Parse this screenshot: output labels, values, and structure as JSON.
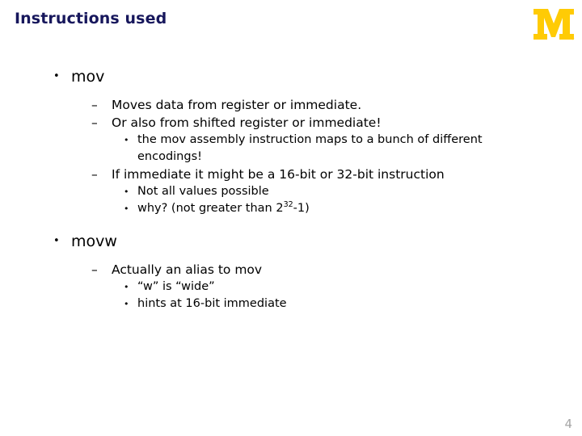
{
  "slide": {
    "title": "Instructions used",
    "page_number": "4",
    "title_color": "#17175c",
    "logo": {
      "name": "university-of-michigan-block-m",
      "letter": "M",
      "color": "#ffcb05"
    },
    "outline": [
      {
        "level": 1,
        "bullet": "•",
        "text": "mov"
      },
      {
        "level": 2,
        "bullet": "–",
        "text": "Moves data from register or immediate."
      },
      {
        "level": 2,
        "bullet": "–",
        "text": "Or also from shifted register or immediate!"
      },
      {
        "level": 3,
        "bullet": "•",
        "text": "the mov assembly instruction maps to a bunch of different encodings!"
      },
      {
        "level": 2,
        "bullet": "–",
        "text": "If immediate it might be a 16-bit or 32-bit instruction"
      },
      {
        "level": 3,
        "bullet": "•",
        "text": "Not all values possible"
      },
      {
        "level": 3,
        "bullet": "•",
        "text_before_sup": "why? (not greater than 2",
        "sup": "32",
        "text_after_sup": "-1)"
      },
      {
        "level": 1,
        "bullet": "•",
        "text": "movw"
      },
      {
        "level": 2,
        "bullet": "–",
        "text": "Actually an alias to mov"
      },
      {
        "level": 3,
        "bullet": "•",
        "text": "“w” is “wide”"
      },
      {
        "level": 3,
        "bullet": "•",
        "text": "hints at 16-bit immediate"
      }
    ]
  }
}
